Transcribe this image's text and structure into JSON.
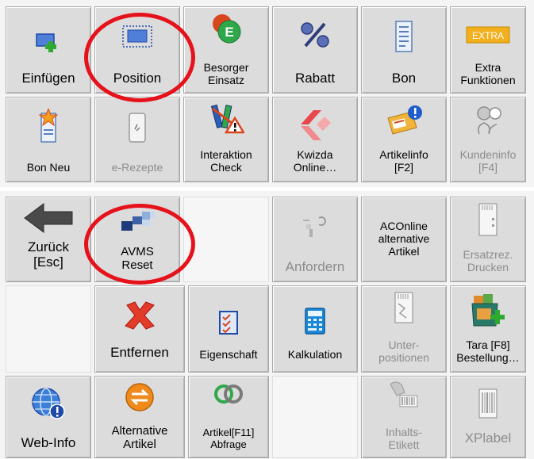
{
  "top_panel": {
    "row1": {
      "einfuegen": "Einfügen",
      "position": "Position",
      "besorger": "Besorger\nEinsatz",
      "rabatt": "Rabatt",
      "bon": "Bon",
      "extra": "Extra\nFunktionen",
      "extra_badge": "EXTRA"
    },
    "row2": {
      "bon_neu": "Bon Neu",
      "erezepte": "e-Rezepte",
      "interaktion": "Interaktion\nCheck",
      "kwizda": "Kwizda\nOnline…",
      "artikelinfo": "Artikelinfo\n[F2]",
      "kundeninfo": "Kundeninfo\n[F4]"
    }
  },
  "bottom_panel": {
    "row1": {
      "zurueck": "Zurück\n[Esc]",
      "avms": "AVMS\nReset",
      "anfordern": "Anfordern",
      "aconline": "ACOnline\nalternative\nArtikel",
      "ersatzrez": "Ersatzrez.\nDrucken"
    },
    "row2": {
      "entfernen": "Entfernen",
      "eigenschaft": "Eigenschaft",
      "kalkulation": "Kalkulation",
      "unterpositionen": "Unter-\npositionen",
      "tara": "Tara [F8]\nBestellung…"
    },
    "row3": {
      "webinfo": "Web-Info",
      "alternative": "Alternative\nArtikel",
      "artikelabfrage": "Artikel[F11]\nAbfrage",
      "inhalts": "Inhalts-\nEtikett",
      "xplabel": "XPlabel"
    }
  },
  "colors": {
    "highlight_circle": "#e6121b",
    "button_face": "#dcdcdc",
    "disabled_text": "#8c8c8c"
  },
  "icons": {
    "einfuegen": "insert-plus-icon",
    "position": "position-frame-icon",
    "besorger": "besorger-e-icon",
    "rabatt": "percent-icon",
    "bon": "receipt-icon",
    "extra": "extra-badge-icon",
    "bon_neu": "new-receipt-icon",
    "erezepte": "phone-prescription-icon",
    "interaktion": "interaction-warning-icon",
    "kwizda": "kwizda-logo-icon",
    "artikelinfo": "article-info-icon",
    "kundeninfo": "customer-info-icon",
    "zurueck": "back-arrow-icon",
    "avms": "avms-blocks-icon",
    "anfordern": "request-icon",
    "ersatzrez": "reprint-prescription-icon",
    "entfernen": "remove-x-icon",
    "eigenschaft": "checklist-icon",
    "kalkulation": "calculator-icon",
    "unterpositionen": "sub-positions-icon",
    "tara": "tara-bag-icon",
    "webinfo": "globe-info-icon",
    "alternative": "swap-arrows-icon",
    "artikelabfrage": "rings-icon",
    "inhalts": "barcode-label-icon",
    "xplabel": "xplabel-barcode-icon"
  }
}
